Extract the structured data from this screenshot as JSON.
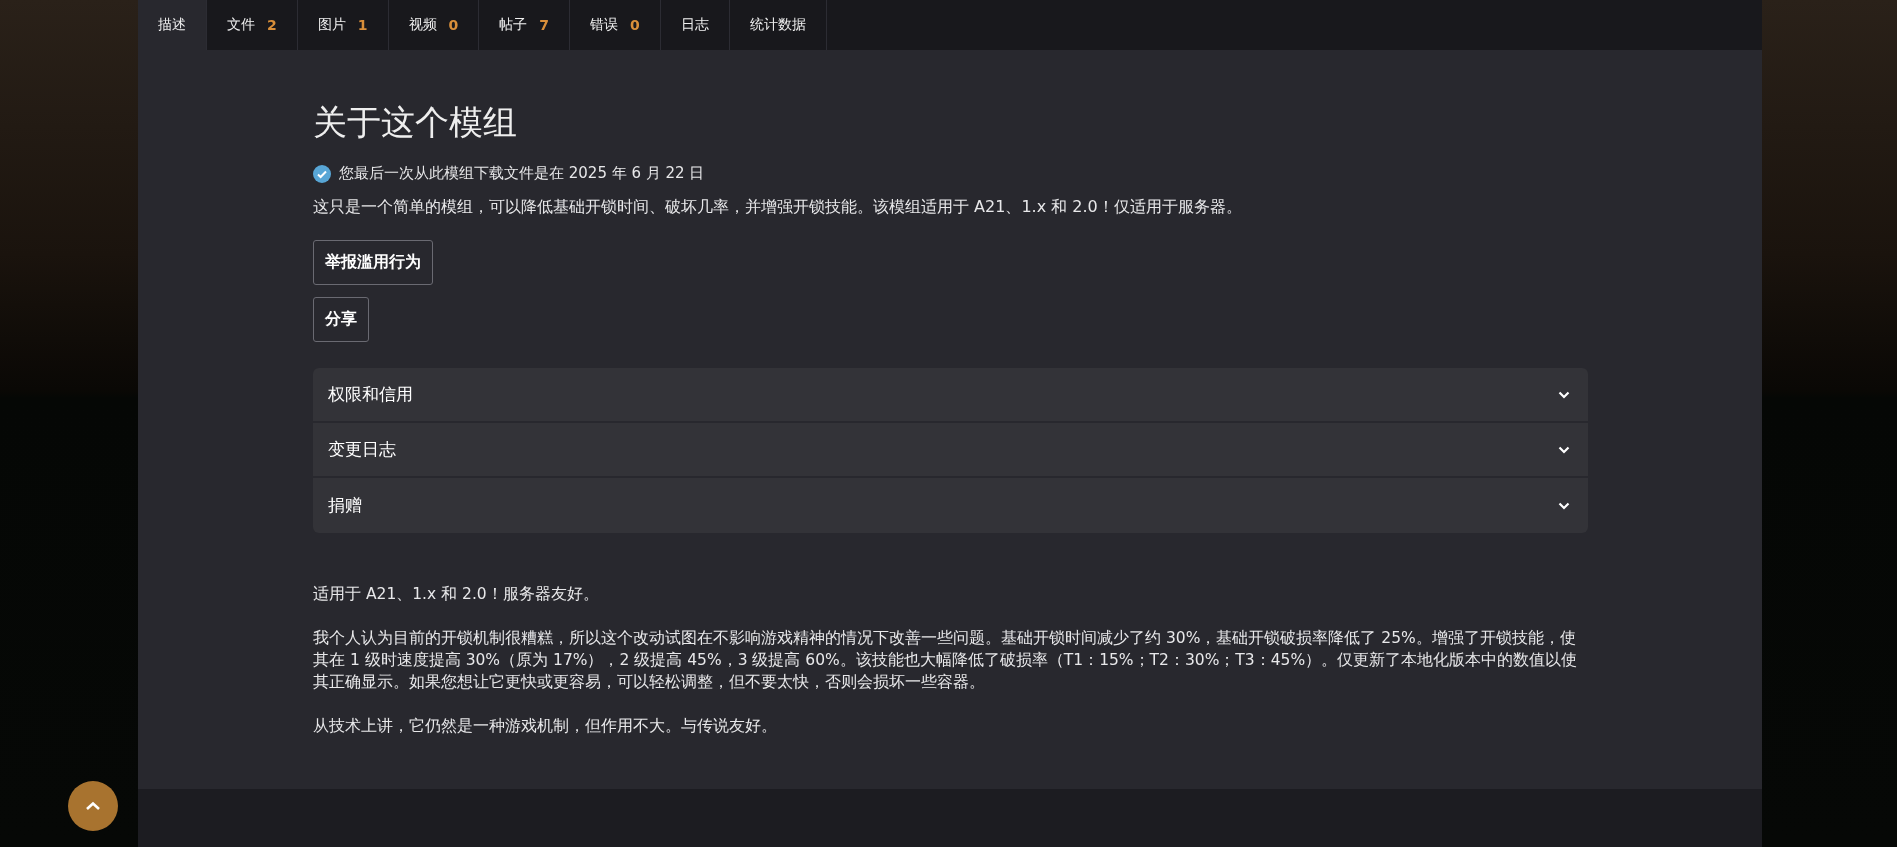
{
  "tabs": [
    {
      "label": "描述",
      "selected": true
    },
    {
      "label": "文件",
      "count": "2",
      "selected": false
    },
    {
      "label": "图片",
      "count": "1",
      "selected": false
    },
    {
      "label": "视频",
      "count": "0",
      "selected": false
    },
    {
      "label": "帖子",
      "count": "7",
      "selected": false
    },
    {
      "label": "错误",
      "count": "0",
      "selected": false
    },
    {
      "label": "日志",
      "selected": false
    },
    {
      "label": "统计数据",
      "selected": false
    }
  ],
  "about": {
    "title": "关于这个模组",
    "download_notice": "您最后一次从此模组下载文件是在 2025 年 6 月 22 日",
    "summary": "这只是一个简单的模组，可以降低基础开锁时间、破坏几率，并增强开锁技能。该模组适用于 A21、1.x 和 2.0！仅适用于服务器。",
    "buttons": [
      "举报滥用行为",
      "分享"
    ]
  },
  "accordion": [
    {
      "label": "权限和信用",
      "expanded": false
    },
    {
      "label": "变更日志",
      "expanded": false
    },
    {
      "label": "捐赠",
      "expanded": false
    }
  ],
  "description": [
    "适用于 A21、1.x 和 2.0！服务器友好。",
    "我个人认为目前的开锁机制很糟糕，所以这个改动试图在不影响游戏精神的情况下改善一些问题。基础开锁时间减少了约 30%，基础开锁破损率降低了 25%。增强了开锁技能，使其在 1 级时速度提高 30%（原为 17%），2 级提高 45%，3 级提高 60%。该技能也大幅降低了破损率（T1：15%；T2：30%；T3：45%）。仅更新了本地化版本中的数值以使其正确显示。如果您想让它更快或更容易，可以轻松调整，但不要太快，否则会损坏一些容器。",
    "从技术上讲，它仍然是一种游戏机制，但作用不大。与传说友好。"
  ]
}
